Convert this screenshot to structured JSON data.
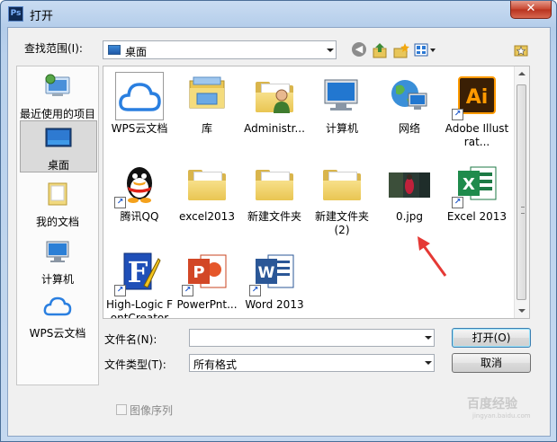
{
  "window": {
    "title": "打开",
    "app_icon": "Ps",
    "close_glyph": "✕"
  },
  "lookin": {
    "label": "查找范围(I):",
    "value": "桌面"
  },
  "sidebar": {
    "items": [
      {
        "label": "最近使用的项目",
        "icon": "recent-items-icon"
      },
      {
        "label": "桌面",
        "icon": "desktop-icon",
        "selected": true
      },
      {
        "label": "我的文档",
        "icon": "documents-icon"
      },
      {
        "label": "计算机",
        "icon": "computer-icon"
      },
      {
        "label": "WPS云文档",
        "icon": "cloud-icon"
      }
    ]
  },
  "files": [
    {
      "name": "WPS云文档",
      "icon": "wps-cloud-icon"
    },
    {
      "name": "库",
      "icon": "library-icon"
    },
    {
      "name": "Administr...",
      "icon": "user-folder-icon"
    },
    {
      "name": "计算机",
      "icon": "computer-icon"
    },
    {
      "name": "网络",
      "icon": "network-icon"
    },
    {
      "name": "Adobe Illustrat...",
      "icon": "illustrator-icon",
      "shortcut": true
    },
    {
      "name": "腾讯QQ",
      "icon": "qq-icon",
      "shortcut": true
    },
    {
      "name": "excel2013",
      "icon": "folder-icon"
    },
    {
      "name": "新建文件夹",
      "icon": "folder-icon"
    },
    {
      "name": "新建文件夹 (2)",
      "icon": "folder-icon"
    },
    {
      "name": "0.jpg",
      "icon": "image-thumbnail-icon"
    },
    {
      "name": "Excel 2013",
      "icon": "excel-icon",
      "shortcut": true
    },
    {
      "name": "High-Logic FontCreator",
      "icon": "fontcreator-icon",
      "shortcut": true
    },
    {
      "name": "PowerPnt...",
      "icon": "powerpoint-icon",
      "shortcut": true
    },
    {
      "name": "Word 2013",
      "icon": "word-icon",
      "shortcut": true
    }
  ],
  "filename": {
    "label": "文件名(N):",
    "value": ""
  },
  "filetype": {
    "label": "文件类型(T):",
    "value": "所有格式"
  },
  "buttons": {
    "open": "打开(O)",
    "cancel": "取消"
  },
  "image_sequence": {
    "label": "图像序列",
    "checked": false
  },
  "watermark": {
    "text": "百度经验",
    "sub": "jingyan.baidu.com"
  },
  "colors": {
    "accent": "#1e6fd0",
    "annotation_arrow": "#e53935",
    "title_bar": "#b9d1ec"
  }
}
